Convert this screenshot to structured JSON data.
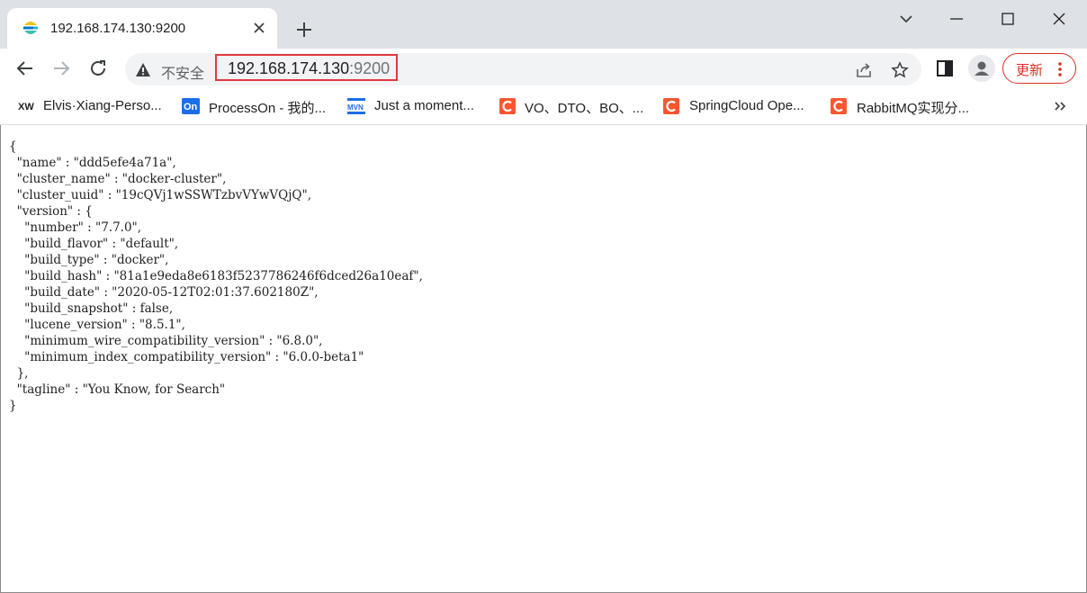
{
  "tab": {
    "title": "192.168.174.130:9200",
    "favicon": "elastic-icon"
  },
  "toolbar": {
    "security_label": "不安全",
    "url_host": "192.168.174.130",
    "url_port": ":9200",
    "update_label": "更新"
  },
  "bookmarks": [
    {
      "label": "Elvis·Xiang-Perso...",
      "icon": "XW"
    },
    {
      "label": "ProcessOn - 我的...",
      "icon": "On"
    },
    {
      "label": "Just a moment...",
      "icon": "MVN"
    },
    {
      "label": "VO、DTO、BO、...",
      "icon": "C"
    },
    {
      "label": "SpringCloud Ope...",
      "icon": "C"
    },
    {
      "label": "RabbitMQ实现分...",
      "icon": "C"
    }
  ],
  "colors": {
    "highlight_border": "#e0393e",
    "csdn_orange": "#fc5531",
    "processon_blue": "#1b6ee8",
    "update_red": "#d93025"
  },
  "json_lines": [
    "{",
    "  \"name\" : \"ddd5efe4a71a\",",
    "  \"cluster_name\" : \"docker-cluster\",",
    "  \"cluster_uuid\" : \"19cQVj1wSSWTzbvVYwVQjQ\",",
    "  \"version\" : {",
    "    \"number\" : \"7.7.0\",",
    "    \"build_flavor\" : \"default\",",
    "    \"build_type\" : \"docker\",",
    "    \"build_hash\" : \"81a1e9eda8e6183f5237786246f6dced26a10eaf\",",
    "    \"build_date\" : \"2020-05-12T02:01:37.602180Z\",",
    "    \"build_snapshot\" : false,",
    "    \"lucene_version\" : \"8.5.1\",",
    "    \"minimum_wire_compatibility_version\" : \"6.8.0\",",
    "    \"minimum_index_compatibility_version\" : \"6.0.0-beta1\"",
    "  },",
    "  \"tagline\" : \"You Know, for Search\"",
    "}"
  ]
}
